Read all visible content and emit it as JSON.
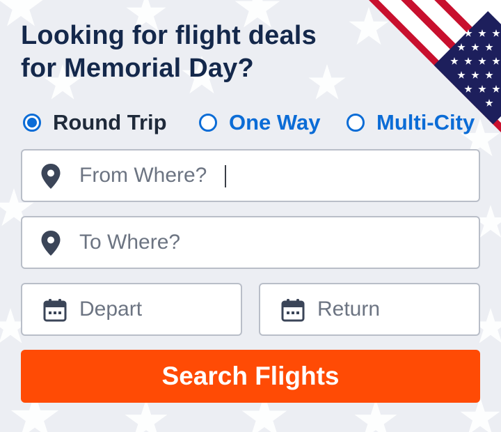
{
  "headline": {
    "line1": "Looking for flight deals",
    "line2": "for Memorial Day?"
  },
  "trip_type": {
    "selected": "Round Trip",
    "options": [
      {
        "label": "Round Trip",
        "selected": true
      },
      {
        "label": "One Way",
        "selected": false
      },
      {
        "label": "Multi-City",
        "selected": false
      }
    ]
  },
  "fields": {
    "from": {
      "placeholder": "From Where?",
      "value": "",
      "icon": "location-pin-icon",
      "focused": true
    },
    "to": {
      "placeholder": "To Where?",
      "value": "",
      "icon": "location-pin-icon"
    },
    "depart": {
      "placeholder": "Depart",
      "value": "",
      "icon": "calendar-icon"
    },
    "return": {
      "placeholder": "Return",
      "value": "",
      "icon": "calendar-icon"
    }
  },
  "search_button": {
    "label": "Search Flights"
  },
  "colors": {
    "headline": "#14284b",
    "accent_blue": "#0b6cd6",
    "button_orange": "#ff4b05",
    "field_border": "#b9bec8",
    "background": "#eceef3",
    "flag_red": "#c8102e",
    "flag_blue": "#1d1f5c"
  },
  "decorations": {
    "background_pattern": "white-stars",
    "corner_graphic": "us-flag-corner"
  }
}
